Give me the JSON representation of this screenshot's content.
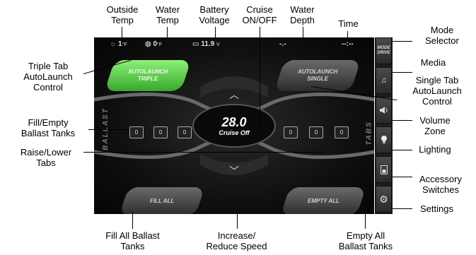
{
  "callouts": {
    "outside_temp": "Outside\nTemp",
    "water_temp": "Water\nTemp",
    "battery_voltage": "Battery\nVoltage",
    "cruise_onoff": "Cruise\nON/OFF",
    "water_depth": "Water\nDepth",
    "time": "Time",
    "mode_selector": "Mode\nSelector",
    "media": "Media",
    "single_tab": "Single Tab\nAutoLaunch\nControl",
    "volume_zone": "Volume\nZone",
    "lighting": "Lighting",
    "accessory": "Accessory\nSwitches",
    "settings": "Settings",
    "triple_tab": "Triple Tab\nAutoLaunch\nControl",
    "fill_empty": "Fill/Empty\nBallast Tanks",
    "raise_lower": "Raise/Lower\nTabs",
    "fill_all_ballast": "Fill All Ballast\nTanks",
    "increase_reduce": "Increase/\nReduce Speed",
    "empty_all_ballast": "Empty All\nBallast Tanks"
  },
  "status": {
    "outside_temp": "1",
    "outside_unit": "°F",
    "water_temp": "0",
    "water_unit": "°F",
    "battery": "11.9",
    "battery_unit": "V",
    "depth": "-.-",
    "time": "--:--"
  },
  "screen": {
    "autolaunch_triple": "AUTOLAUNCH\nTRIPLE",
    "autolaunch_single": "AUTOLAUNCH\nSINGLE",
    "fill_all": "FILL ALL",
    "empty_all": "EMPTY ALL",
    "speed": "28.0",
    "cruise_status": "Cruise Off",
    "ballast_label": "BALLAST",
    "tabs_label": "TABS",
    "ballast_left": [
      "0",
      "0",
      "0"
    ],
    "ballast_right": [
      "0",
      "0",
      "0"
    ]
  },
  "rightbar": {
    "mode_label": "MODE\nDRIVE"
  },
  "colors": {
    "accent_green": "#4ccf3a",
    "screen_bg": "#101010"
  }
}
